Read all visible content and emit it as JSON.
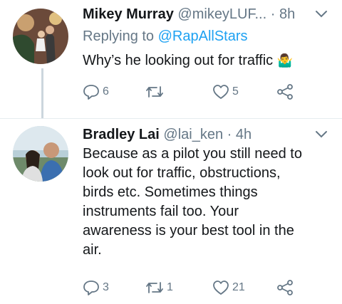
{
  "tweets": [
    {
      "name": "Mikey Murray",
      "handle": "@mikeyLUF...",
      "separator": "·",
      "time": "8h",
      "reply_prefix": "Replying to",
      "reply_mention": "@RapAllStars",
      "text": "Why’s he looking out for traffic",
      "emoji": "🤷‍♂️",
      "replies": "6",
      "retweets": "",
      "likes": "5"
    },
    {
      "name": "Bradley Lai",
      "handle": "@lai_ken",
      "separator": "·",
      "time": "4h",
      "text_lines": [
        "Because as a pilot you still need to",
        "look out for traffic, obstructions,",
        "birds etc. Sometimes things",
        "instruments fail too. Your",
        "awareness is your best tool in the",
        "air."
      ],
      "replies": "3",
      "retweets": "1",
      "likes": "21"
    }
  ],
  "colors": {
    "link": "#1da1f2",
    "muted": "#657786",
    "text": "#14171a",
    "line": "#ccd6dd"
  }
}
